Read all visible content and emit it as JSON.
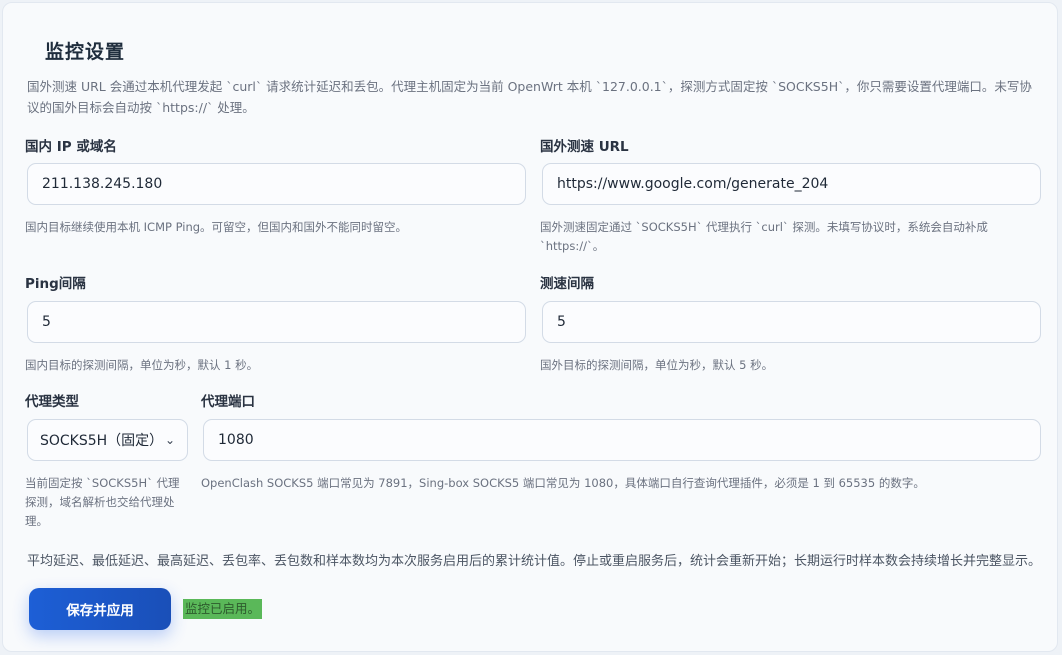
{
  "title": "监控设置",
  "description": "国外测速 URL 会通过本机代理发起 `curl` 请求统计延迟和丢包。代理主机固定为当前 OpenWrt 本机 `127.0.0.1`，探测方式固定按 `SOCKS5H`，你只需要设置代理端口。未写协议的国外目标会自动按 `https://` 处理。",
  "domestic": {
    "label": "国内 IP 或域名",
    "value": "211.138.245.180",
    "hint": "国内目标继续使用本机 ICMP Ping。可留空，但国内和国外不能同时留空。"
  },
  "foreign": {
    "label": "国外测速 URL",
    "value": "https://www.google.com/generate_204",
    "hint": "国外测速固定通过 `SOCKS5H` 代理执行 `curl` 探测。未填写协议时，系统会自动补成 `https://`。"
  },
  "ping_interval": {
    "label": "Ping间隔",
    "value": "5",
    "hint": "国内目标的探测间隔，单位为秒，默认 1 秒。"
  },
  "speed_interval": {
    "label": "测速间隔",
    "value": "5",
    "hint": "国外目标的探测间隔，单位为秒，默认 5 秒。"
  },
  "proxy_type": {
    "label": "代理类型",
    "value": "SOCKS5H（固定）",
    "hint": "当前固定按 `SOCKS5H` 代理探测，域名解析也交给代理处理。"
  },
  "proxy_port": {
    "label": "代理端口",
    "value": "1080",
    "hint": "OpenClash SOCKS5 端口常见为 7891，Sing-box SOCKS5 端口常见为 1080，具体端口自行查询代理插件，必须是 1 到 65535 的数字。"
  },
  "note": "平均延迟、最低延迟、最高延迟、丢包率、丢包数和样本数均为本次服务启用后的累计统计值。停止或重启服务后，统计会重新开始；长期运行时样本数会持续增长并完整显示。",
  "save_label": "保存并应用",
  "status": "监控已启用。",
  "icons": {
    "select_chevron": "chevron-down-icon"
  },
  "colors": {
    "accent": "#1d5fd6",
    "status_bg": "#5ab859"
  }
}
